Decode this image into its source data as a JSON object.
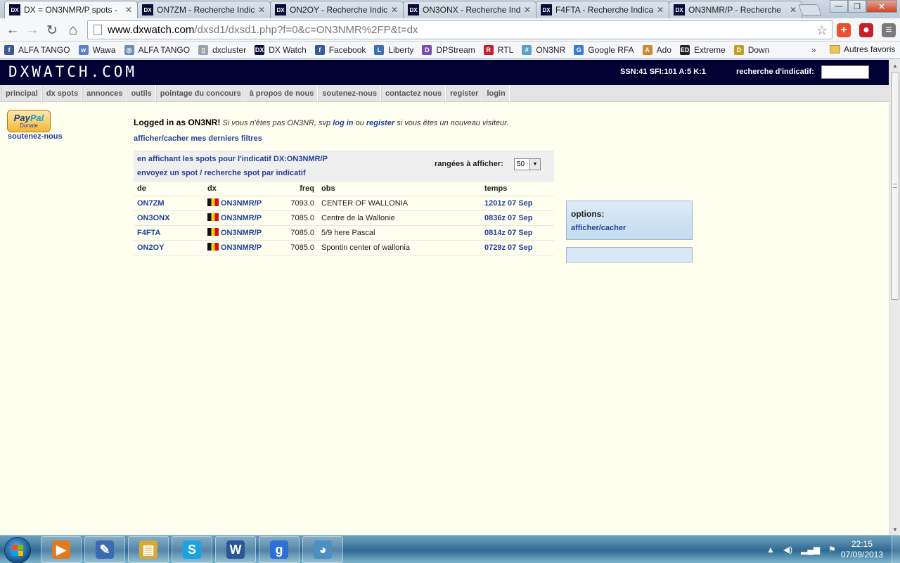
{
  "browser": {
    "tabs": [
      {
        "favicon": "DX",
        "title": "DX = ON3NMR/P spots -",
        "active": true
      },
      {
        "favicon": "DX",
        "title": "ON7ZM - Recherche Indic",
        "active": false
      },
      {
        "favicon": "DX",
        "title": "ON2OY - Recherche Indic",
        "active": false
      },
      {
        "favicon": "DX",
        "title": "ON3ONX - Recherche Ind",
        "active": false
      },
      {
        "favicon": "DX",
        "title": "F4FTA - Recherche Indica",
        "active": false
      },
      {
        "favicon": "DX",
        "title": "ON3NMR/P - Recherche",
        "active": false
      }
    ],
    "tab_close": "✕",
    "window_controls": {
      "minimize": "—",
      "maximize": "❐",
      "close": "✕"
    },
    "nav_icons": {
      "back": "arrow-left-icon",
      "forward": "arrow-right-icon",
      "reload": "reload-icon",
      "home": "home-icon"
    },
    "nav_glyphs": {
      "back": "←",
      "forward": "→",
      "reload": "↻",
      "home": "⌂"
    },
    "address": {
      "host": "www.dxwatch.com",
      "path": "/dxsd1/dxsd1.php?f=0&c=ON3NMR%2FP&t=dx",
      "star": "☆"
    },
    "extensions": [
      {
        "name": "plus-extension-icon",
        "glyph": "+",
        "color": "#e8502f"
      },
      {
        "name": "adblock-extension-icon",
        "glyph": "●",
        "color": "#c8202a"
      },
      {
        "name": "menu-wrench-icon",
        "glyph": "≡",
        "color": "#7a7a7a"
      }
    ],
    "bookmarks": [
      {
        "label": "ALFA TANGO",
        "icon": "facebook-icon",
        "glyph": "f",
        "color": "#3b5998"
      },
      {
        "label": "Wawa",
        "icon": "wawa-icon",
        "glyph": "w",
        "color": "#5a7fd0"
      },
      {
        "label": "ALFA TANGO",
        "icon": "globe-icon",
        "glyph": "◎",
        "color": "#6c8fb5"
      },
      {
        "label": "dxcluster",
        "icon": "page-icon",
        "glyph": "▯",
        "color": "#9aa3ad"
      },
      {
        "label": "DX Watch",
        "icon": "dxwatch-icon",
        "glyph": "DX",
        "color": "#0b0b3b"
      },
      {
        "label": "Facebook",
        "icon": "facebook-icon",
        "glyph": "f",
        "color": "#3b5998"
      },
      {
        "label": "Liberty",
        "icon": "liberty-icon",
        "glyph": "L",
        "color": "#3f6fb0"
      },
      {
        "label": "DPStream",
        "icon": "dpstream-icon",
        "glyph": "D",
        "color": "#7b4bb5"
      },
      {
        "label": "RTL",
        "icon": "rtl-icon",
        "glyph": "R",
        "color": "#c02030"
      },
      {
        "label": "ON3NR",
        "icon": "grid-icon",
        "glyph": "#",
        "color": "#5aa0c8"
      },
      {
        "label": "Google RFA",
        "icon": "google-rfa-icon",
        "glyph": "G",
        "color": "#3a7ad6"
      },
      {
        "label": "Ado",
        "icon": "ado-icon",
        "glyph": "A",
        "color": "#d08a2a"
      },
      {
        "label": "Extreme",
        "icon": "extreme-icon",
        "glyph": "ED",
        "color": "#222222"
      },
      {
        "label": "Down",
        "icon": "down-icon",
        "glyph": "D",
        "color": "#c0a020"
      }
    ],
    "bookmarks_more": "»",
    "other_bookmarks": "Autres favoris"
  },
  "site": {
    "logo": "DXWATCH.COM",
    "solar": "SSN:41 SFI:101 A:5 K:1",
    "search_label": "recherche d'indicatif:",
    "search_value": "",
    "nav": [
      "principal",
      "dx spots",
      "annonces",
      "outils",
      "pointage du concours",
      "à propos de nous",
      "soutenez-nous",
      "contactez nous",
      "register",
      "login"
    ],
    "donate": {
      "brand_a": "Pay",
      "brand_b": "Pal",
      "label": "Donate"
    },
    "support_link": "soutenez-nous",
    "login": {
      "prefix": "Logged in as ON3NR!",
      "text1": " Si vous n'êtes pas ON3NR, svp ",
      "login_link": "log in",
      "text2": " ou ",
      "register_link": "register",
      "text3": " si vous êtes un nouveau visiteur."
    },
    "filters_link": "afficher/cacher mes derniers filtres",
    "spots": {
      "showing": "en affichant les spots pour l'indicatif DX:ON3NMR/P",
      "send_spot": "envoyez un spot",
      "sep": " / ",
      "search_spot": "recherche spot par indicatif",
      "rows_label": "rangées à afficher:",
      "rows_value": "50",
      "columns": [
        "de",
        "dx",
        "freq",
        "obs",
        "temps"
      ],
      "rows": [
        {
          "de": "ON7ZM",
          "dx": "ON3NMR/P",
          "freq": "7093.0",
          "obs": "CENTER OF WALLONIA",
          "temps": "1201z 07 Sep"
        },
        {
          "de": "ON3ONX",
          "dx": "ON3NMR/P",
          "freq": "7085.0",
          "obs": "Centre de la Wallonie",
          "temps": "0836z 07 Sep"
        },
        {
          "de": "F4FTA",
          "dx": "ON3NMR/P",
          "freq": "7085.0",
          "obs": "5/9 here Pascal",
          "temps": "0814z 07 Sep"
        },
        {
          "de": "ON2OY",
          "dx": "ON3NMR/P",
          "freq": "7085.0",
          "obs": "Spontin center of wallonia",
          "temps": "0729z 07 Sep"
        }
      ]
    },
    "options": {
      "title": "options:",
      "toggle": "afficher/cacher"
    }
  },
  "taskbar": {
    "apps": [
      {
        "name": "media-player-icon",
        "glyph": "▶",
        "color": "#e07a20"
      },
      {
        "name": "paint-brush-icon",
        "glyph": "✎",
        "color": "#3c6ab0"
      },
      {
        "name": "file-explorer-icon",
        "glyph": "▤",
        "color": "#d9a936"
      },
      {
        "name": "skype-icon",
        "glyph": "S",
        "color": "#1aa3e0"
      },
      {
        "name": "word-icon",
        "glyph": "W",
        "color": "#2a5599"
      },
      {
        "name": "google-icon",
        "glyph": "g",
        "color": "#2f6fd8"
      },
      {
        "name": "paint-palette-icon",
        "glyph": "◕",
        "color": "#4d8fc0"
      }
    ],
    "tray": {
      "up": "▲",
      "volume": "◀)",
      "signal": "▂▄▆",
      "flag": "⚑"
    },
    "time": "22:15",
    "date": "07/09/2013"
  }
}
